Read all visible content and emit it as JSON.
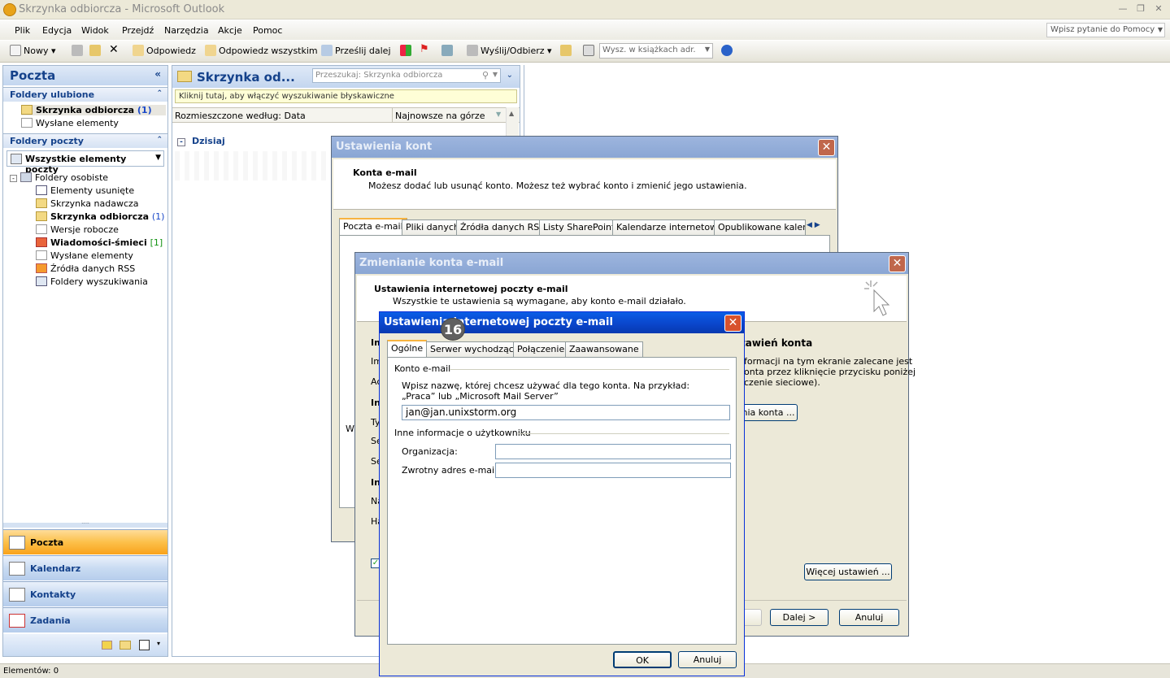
{
  "window": {
    "title": "Skrzynka odbiorcza - Microsoft Outlook"
  },
  "menu": {
    "items": [
      "Plik",
      "Edycja",
      "Widok",
      "Przejdź",
      "Narzędzia",
      "Akcje",
      "Pomoc"
    ],
    "help_placeholder": "Wpisz pytanie do Pomocy"
  },
  "toolbar": {
    "new": "Nowy",
    "reply": "Odpowiedz",
    "reply_all": "Odpowiedz wszystkim",
    "forward": "Prześlij dalej",
    "send_receive": "Wyślij/Odbierz",
    "addr_search": "Wysz. w książkach adr."
  },
  "nav": {
    "title": "Poczta",
    "favorites_header": "Foldery ulubione",
    "favorites": [
      {
        "label": "Skrzynka odbiorcza",
        "count": "(1)"
      },
      {
        "label": "Wysłane elementy",
        "count": ""
      }
    ],
    "mail_folders_header": "Foldery poczty",
    "all_items": "Wszystkie elementy poczty",
    "personal": "Foldery osobiste",
    "folders": [
      {
        "label": "Elementy usunięte",
        "count": ""
      },
      {
        "label": "Skrzynka nadawcza",
        "count": ""
      },
      {
        "label": "Skrzynka odbiorcza",
        "count": "(1)"
      },
      {
        "label": "Wersje robocze",
        "count": ""
      },
      {
        "label": "Wiadomości-śmieci",
        "count": "[1]"
      },
      {
        "label": "Wysłane elementy",
        "count": ""
      },
      {
        "label": "Źródła danych RSS",
        "count": ""
      },
      {
        "label": "Foldery wyszukiwania",
        "count": ""
      }
    ],
    "buttons": [
      "Poczta",
      "Kalendarz",
      "Kontakty",
      "Zadania"
    ]
  },
  "maillist": {
    "title": "Skrzynka od...",
    "search_placeholder": "Przeszukaj: Skrzynka odbiorcza",
    "instant_search": "Kliknij tutaj, aby włączyć wyszukiwanie błyskawiczne",
    "sort_by": "Rozmieszczone według: Data",
    "sort_order": "Najnowsze na górze",
    "group_today": "Dzisiaj"
  },
  "status": {
    "items": "Elementów: 0"
  },
  "account_settings": {
    "title": "Ustawienia kont",
    "heading": "Konta e-mail",
    "desc": "Możesz dodać lub usunąć konto. Możesz też wybrać konto i zmienić jego ustawienia.",
    "tabs": [
      "Poczta e-mail",
      "Pliki danych",
      "Źródła danych RSS",
      "Listy SharePoint",
      "Kalendarze internetowe",
      "Opublikowane kalenda"
    ]
  },
  "change_account": {
    "title": "Zmienianie konta e-mail",
    "heading": "Ustawienia internetowej poczty e-mail",
    "desc": "Wszystkie te ustawienia są wymagane, aby konto e-mail działało.",
    "right_heading": "tawień konta",
    "right_text": [
      "formacji na tym ekranie zalecane jest",
      "onta przez kliknięcie przycisku poniżej",
      "czenie sieciowe)."
    ],
    "test_button": "nia konta ...",
    "more_settings": "Więcej ustawień ...",
    "back": "ecz",
    "next": "Dalej >",
    "cancel": "Anuluj",
    "left_fragments": [
      "Im",
      "Im",
      "Ac",
      "In",
      "Ty",
      "Se",
      "Se",
      "In",
      "Na",
      "Ha",
      "W"
    ]
  },
  "inet_settings": {
    "title": "Ustawienia internetowej poczty e-mail",
    "badge": "16",
    "tabs": [
      "Ogólne",
      "Serwer wychodzący",
      "Połączenie",
      "Zaawansowane"
    ],
    "group_account": "Konto e-mail",
    "account_hint": "Wpisz nazwę, której chcesz używać dla tego konta. Na przykład: „Praca” lub „Microsoft Mail Server”",
    "account_name": "jan@jan.unixstorm.org",
    "group_other": "Inne informacje o użytkowniku",
    "org_label": "Organizacja:",
    "org_value": "",
    "reply_label": "Zwrotny adres e-mail:",
    "reply_value": "",
    "ok": "OK",
    "cancel": "Anuluj"
  }
}
